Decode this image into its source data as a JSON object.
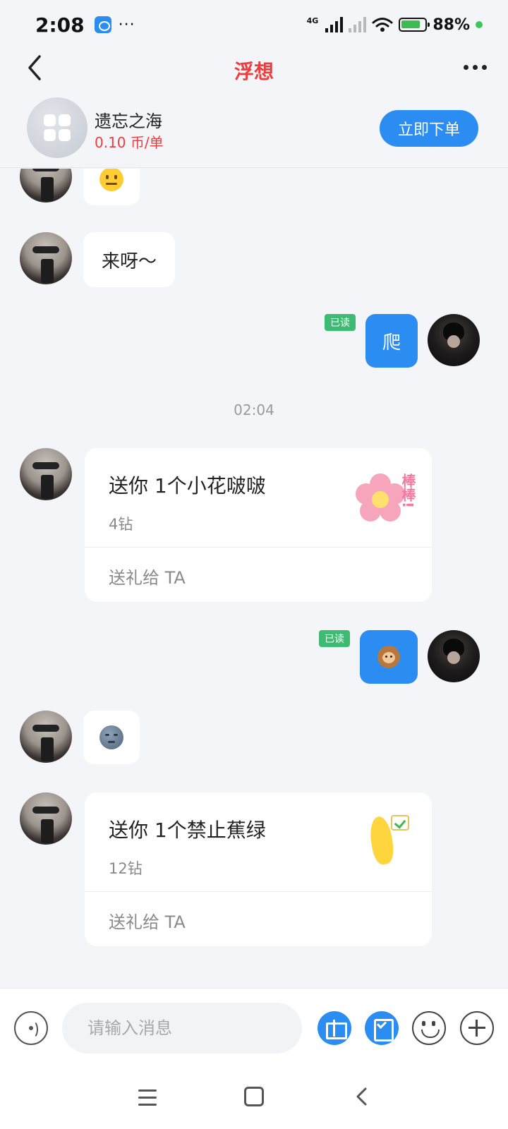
{
  "status_bar": {
    "time": "2:08",
    "network": "4G",
    "battery": "88%",
    "dots": "···"
  },
  "header": {
    "title": "浮想"
  },
  "service": {
    "name": "遗忘之海",
    "price": "0.10 币/单",
    "order_button": "立即下单"
  },
  "messages": {
    "m2_text": "来呀～",
    "m3_text": "爬",
    "read_label": "已读",
    "time_divider": "02:04",
    "gift1": {
      "title": "送你 1个小花啵啵",
      "price": "4钻",
      "action": "送礼给 TA",
      "sticker_text": "棒棒!"
    },
    "gift2": {
      "title": "送你 1个禁止蕉绿",
      "price": "12钻",
      "action": "送礼给 TA"
    }
  },
  "input": {
    "placeholder": "请输入消息"
  },
  "colors": {
    "accent_blue": "#2b8cf2",
    "title_red": "#ef3d3d",
    "read_green": "#3dbb73"
  }
}
